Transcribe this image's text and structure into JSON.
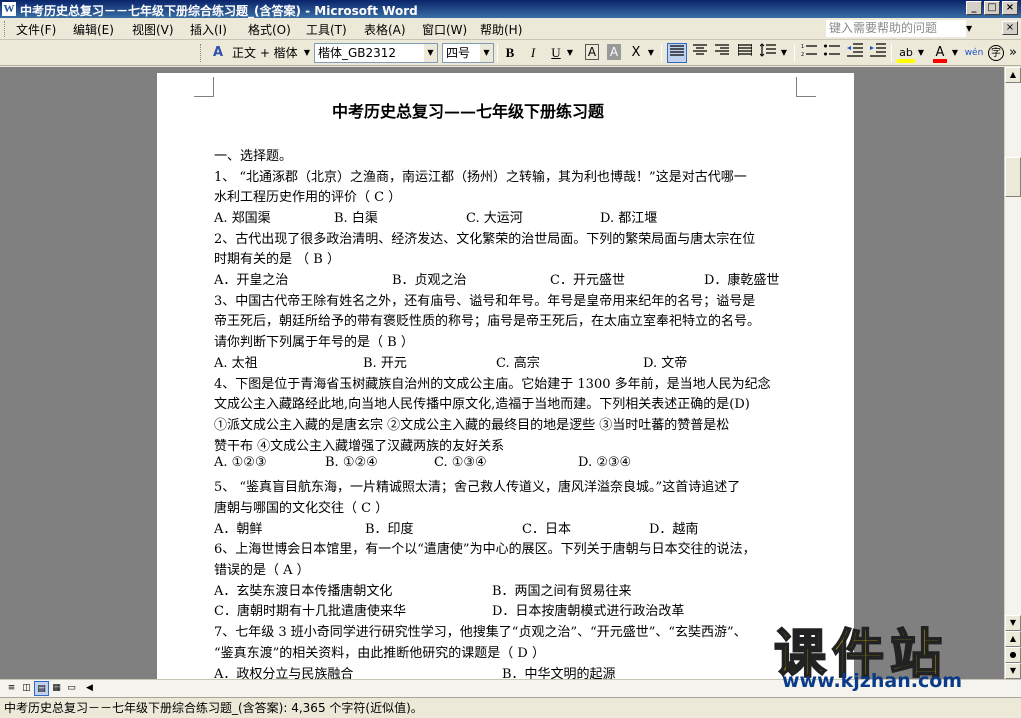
{
  "window": {
    "title": "中考历史总复习－－七年级下册综合练习题_(含答案) - Microsoft Word",
    "app_icon": "W",
    "buttons": {
      "minimize": "_",
      "maximize": "□",
      "close": "×"
    }
  },
  "menubar": {
    "items": [
      "文件(F)",
      "编辑(E)",
      "视图(V)",
      "插入(I)",
      "格式(O)",
      "工具(T)",
      "表格(A)",
      "窗口(W)",
      "帮助(H)"
    ],
    "help_placeholder": "键入需要帮助的问题",
    "doc_close": "×"
  },
  "toolbar": {
    "style_icon": "A",
    "style_value": "正文 + 楷体",
    "font_value": "楷体_GB2312",
    "size_value": "四号",
    "bold": "B",
    "italic": "I",
    "underline": "U",
    "char_border": "A",
    "char_shading": "A",
    "char_scale": "X",
    "highlight": "ab",
    "font_color": "A",
    "phonetic": "wén",
    "enclose": "字",
    "overflow": "»",
    "colors": {
      "highlight": "#ffff00",
      "font_color": "#ff0000"
    }
  },
  "document": {
    "title": "中考历史总复习——七年级下册练习题",
    "lines": [
      "一、选择题。",
      "1、 “北通涿郡（北京）之渔商，南运江都（扬州）之转输，其为利也博哉！”这是对古代哪一",
      "水利工程历史作用的评价（  C  ）",
      "",
      "2、古代出现了很多政治清明、经济发达、文化繁荣的治世局面。下列的繁荣局面与唐太宗在位",
      "时期有关的是                          （  B  ）",
      "",
      "3、中国古代帝王除有姓名之外，还有庙号、谥号和年号。年号是皇帝用来纪年的名号；谥号是",
      "帝王死后，朝廷所给予的带有褒贬性质的称号；庙号是帝王死后，在太庙立室奉祀特立的名号。",
      "请你判断下列属于年号的是（  B  ）",
      "",
      "4、下图是位于青海省玉树藏族自治州的文成公主庙。它始建于 1300 多年前，是当地人民为纪念",
      "文成公主入藏路经此地,向当地人民传播中原文化,造福于当地而建。下列相关表述正确的是(D)",
      "①派文成公主入藏的是唐玄宗     ②文成公主入藏的最终目的地是逻些    ③当时吐蕃的赞普是松",
      "赞干布    ④文成公主入藏增强了汉藏两族的友好关系",
      "",
      "5、 “鉴真盲目航东海，一片精诚照太清；舍己救人传道义，唐风洋溢奈良城。”这首诗追述了",
      "唐朝与哪国的文化交往（  C  ）",
      "",
      "6、上海世博会日本馆里，有一个以“遣唐使”为中心的展区。下列关于唐朝与日本交往的说法，",
      "错误的是（  A  ）",
      "",
      "",
      "7、七年级 3 班小奇同学进行研究性学习，他搜集了“贞观之治”、“开元盛世”、“玄奘西游”、",
      "“鉴真东渡”的相关资料，由此推断他研究的课题是（  D  ）",
      ""
    ],
    "options": {
      "q1": [
        "A. 郑国渠",
        "B. 白渠",
        "C. 大运河",
        "D. 都江堰"
      ],
      "q2": [
        "A．开皇之治",
        "B．贞观之治",
        "C．开元盛世",
        "D．康乾盛世"
      ],
      "q3": [
        "A. 太祖",
        "B. 开元",
        "C. 高宗",
        "D. 文帝"
      ],
      "q4": [
        "A. ①②③",
        "B. ①②④",
        "C. ①③④",
        "D. ②③④"
      ],
      "q5": [
        "A．朝鲜",
        "B．印度",
        "C．日本",
        "D．越南"
      ],
      "q6a": [
        "A．玄奘东渡日本传播唐朝文化",
        "B．两国之间有贸易往来"
      ],
      "q6b": [
        "C．唐朝时期有十几批遣唐使来华",
        "D．日本按唐朝模式进行政治改革"
      ],
      "q7": [
        "A．政权分立与民族融合",
        "B．中华文明的起源"
      ]
    }
  },
  "scrollbar": {
    "up": "▲",
    "down": "▼",
    "prev_page": "▲",
    "next_page": "▼",
    "select_browse": "●",
    "left": "◀",
    "right": "▶"
  },
  "view_buttons": [
    "≡",
    "◫",
    "▤",
    "▦",
    "▭"
  ],
  "statusbar": {
    "text": "中考历史总复习－－七年级下册综合练习题_(含答案): 4,365 个字符(近似值)。"
  },
  "watermark": {
    "text": "课件站",
    "url": "www.kjzhan.com"
  }
}
